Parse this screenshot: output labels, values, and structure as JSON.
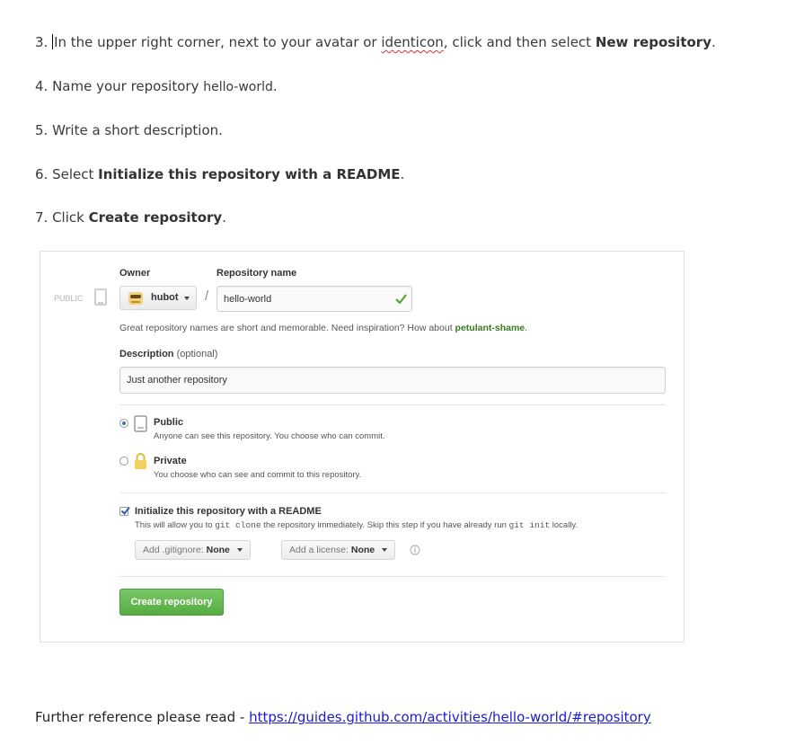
{
  "steps": {
    "s3": {
      "num": "3. ",
      "pre": "In the upper right corner, next to your avatar or ",
      "identicon": "identicon",
      "mid": ", click  and then select ",
      "bold": "New repository",
      "end": "."
    },
    "s4": {
      "text": "4. Name your repository ",
      "code": "hello-world",
      "end": "."
    },
    "s5": {
      "text": "5. Write a short description."
    },
    "s6": {
      "pre": "6. Select ",
      "bold": "Initialize this repository with a README",
      "end": "."
    },
    "s7": {
      "pre": "7. Click ",
      "bold": "Create repository",
      "end": "."
    }
  },
  "form": {
    "public_tag": "PUBLIC",
    "owner_label": "Owner",
    "repo_label": "Repository name",
    "owner_value": "hubot",
    "slash": "/",
    "repo_value": "hello-world",
    "hint_pre": "Great repository names are short and memorable. Need inspiration? How about ",
    "hint_suggestion": "petulant-shame",
    "hint_end": ".",
    "desc_label": "Description",
    "desc_optional": " (optional)",
    "desc_value": "Just another repository",
    "public_title": "Public",
    "public_desc": "Anyone can see this repository. You choose who can commit.",
    "private_title": "Private",
    "private_desc": "You choose who can see and commit to this repository.",
    "init_title": "Initialize this repository with a README",
    "init_desc_1": "This will allow you to ",
    "init_code_1": "git clone",
    "init_desc_2": " the repository immediately. Skip this step if you have already run ",
    "init_code_2": "git init",
    "init_desc_3": " locally.",
    "gitignore_label": "Add .gitignore: ",
    "gitignore_value": "None",
    "license_label": "Add a license: ",
    "license_value": "None",
    "create_label": "Create repository",
    "visibility_selected": "public",
    "init_checked": true,
    "colors": {
      "green": "#55a532",
      "suggestion": "#3a7a20",
      "radio": "#3b6fc2"
    }
  },
  "reference": {
    "text": "Further reference please read - ",
    "link": "https://guides.github.com/activities/hello-world/#repository"
  }
}
